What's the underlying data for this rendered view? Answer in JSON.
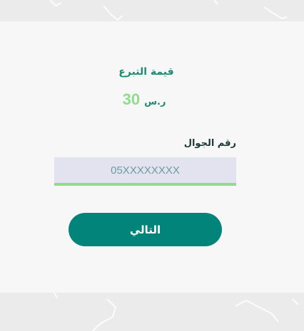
{
  "donation": {
    "label": "قيمة التبرع",
    "amount": "30",
    "currency": "ر.س"
  },
  "phone": {
    "label": "رقم الجوال",
    "placeholder": "05XXXXXXXX",
    "value": ""
  },
  "actions": {
    "next_label": "التالي"
  },
  "colors": {
    "primary": "#02847a",
    "accent_green": "#8fdc8d",
    "label_teal": "#1f8a73",
    "card_bg": "#f7f7f7",
    "page_bg": "#ebebeb",
    "input_bg": "#e3e3f0"
  }
}
